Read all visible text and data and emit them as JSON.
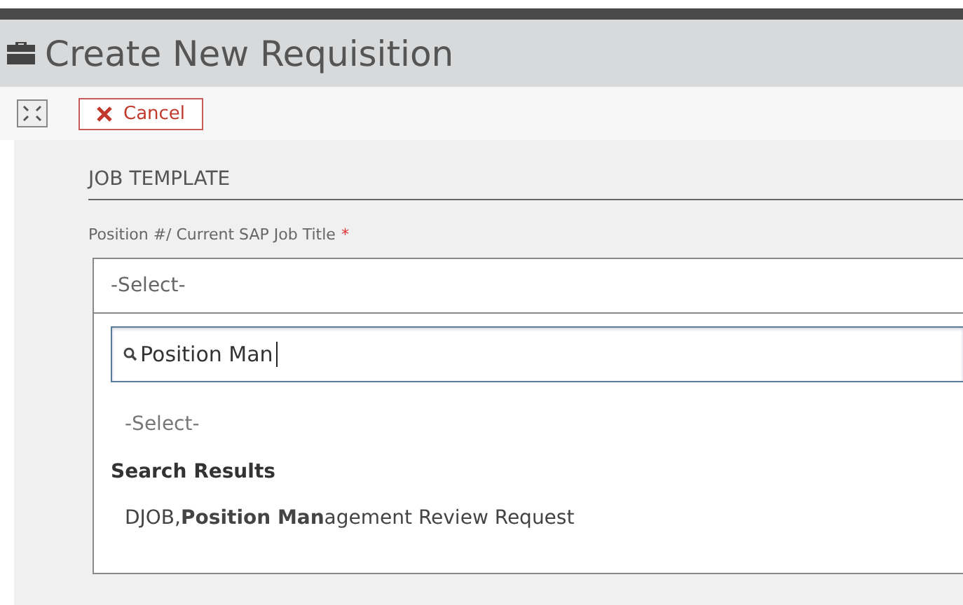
{
  "header": {
    "title": "Create New Requisition"
  },
  "toolbar": {
    "cancel": "Cancel"
  },
  "section": {
    "title": "JOB TEMPLATE"
  },
  "field": {
    "label": "Position #/ Current SAP Job Title",
    "required_mark": "*",
    "value": "-Select-"
  },
  "dropdown": {
    "search": "Position Man",
    "placeholder_option": "-Select-",
    "group_title": "Search Results",
    "results": [
      {
        "text": "DJOB,**Position Man**agement Review Request",
        "selected": false
      }
    ]
  }
}
